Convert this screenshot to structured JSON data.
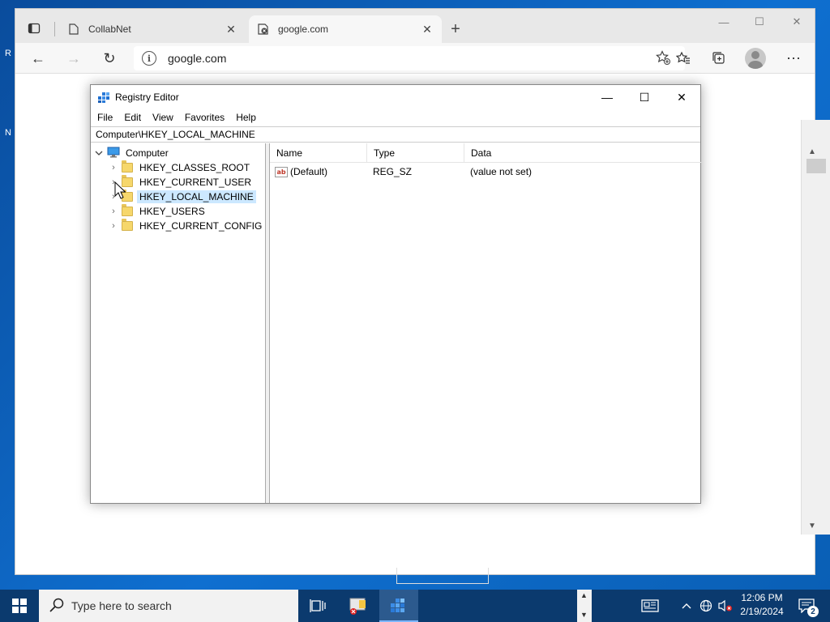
{
  "desktop": {
    "frag_r": "R",
    "frag_n": "N"
  },
  "browser": {
    "tabs": [
      {
        "label": "CollabNet",
        "active": false
      },
      {
        "label": "google.com",
        "active": true
      }
    ],
    "new_tab_glyph": "+",
    "window_controls": {
      "minimize": "—",
      "maximize": "☐",
      "close": "✕"
    },
    "nav": {
      "back": "←",
      "forward": "→",
      "refresh": "↻"
    },
    "address": {
      "info_glyph": "i",
      "url": "google.com"
    },
    "more_glyph": "⋯"
  },
  "regedit": {
    "title": "Registry Editor",
    "controls": {
      "minimize": "—",
      "maximize": "☐",
      "close": "✕"
    },
    "menu": [
      "File",
      "Edit",
      "View",
      "Favorites",
      "Help"
    ],
    "address": "Computer\\HKEY_LOCAL_MACHINE",
    "tree": {
      "root": "Computer",
      "keys": [
        {
          "label": "HKEY_CLASSES_ROOT",
          "selected": false
        },
        {
          "label": "HKEY_CURRENT_USER",
          "selected": false
        },
        {
          "label": "HKEY_LOCAL_MACHINE",
          "selected": true
        },
        {
          "label": "HKEY_USERS",
          "selected": false
        },
        {
          "label": "HKEY_CURRENT_CONFIG",
          "selected": false
        }
      ]
    },
    "columns": [
      "Name",
      "Type",
      "Data"
    ],
    "values": [
      {
        "icon": "ab",
        "name": "(Default)",
        "type": "REG_SZ",
        "data": "(value not set)"
      }
    ]
  },
  "taskbar": {
    "search_placeholder": "Type here to search",
    "time": "12:06 PM",
    "date": "2/19/2024",
    "notification_count": "2"
  }
}
